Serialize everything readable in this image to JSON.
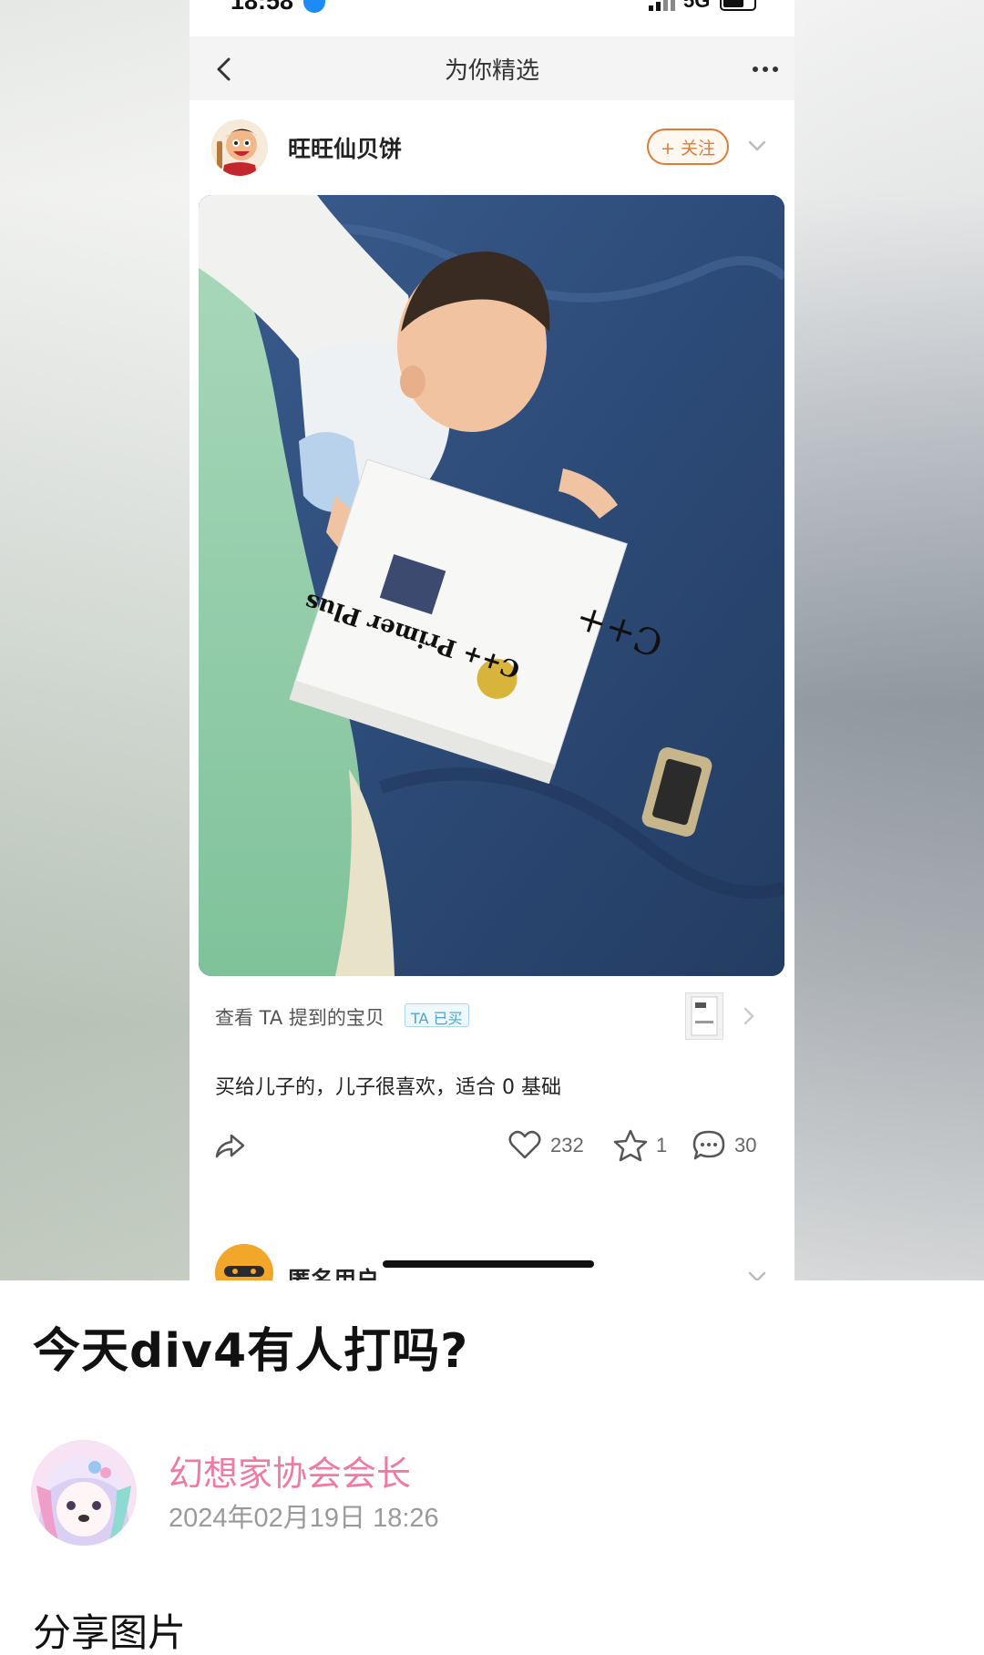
{
  "screenshot": {
    "status_bar": {
      "time": "18:58",
      "network": "5G"
    },
    "nav": {
      "title": "为你精选"
    },
    "author": {
      "name": "旺旺仙贝饼",
      "follow_label": "+ 关注"
    },
    "mentioned_item": {
      "label": "查看 TA 提到的宝贝",
      "badge": "TA 已买"
    },
    "caption": "买给儿子的，儿子很喜欢，适合 0 基础",
    "actions": {
      "likes": "232",
      "favorites": "1",
      "comments": "30"
    },
    "next_post": {
      "name": "匿名用户"
    },
    "book": {
      "title": "C++ Primer Plus"
    }
  },
  "post": {
    "title": "今天div4有人打吗?",
    "author": "幻想家协会会长",
    "timestamp": "2024年02月19日 18:26",
    "body": "分享图片"
  },
  "colors": {
    "author_name": "#ef7ba5",
    "follow_accent": "#e07a35",
    "timestamp": "#9a9a9a"
  }
}
